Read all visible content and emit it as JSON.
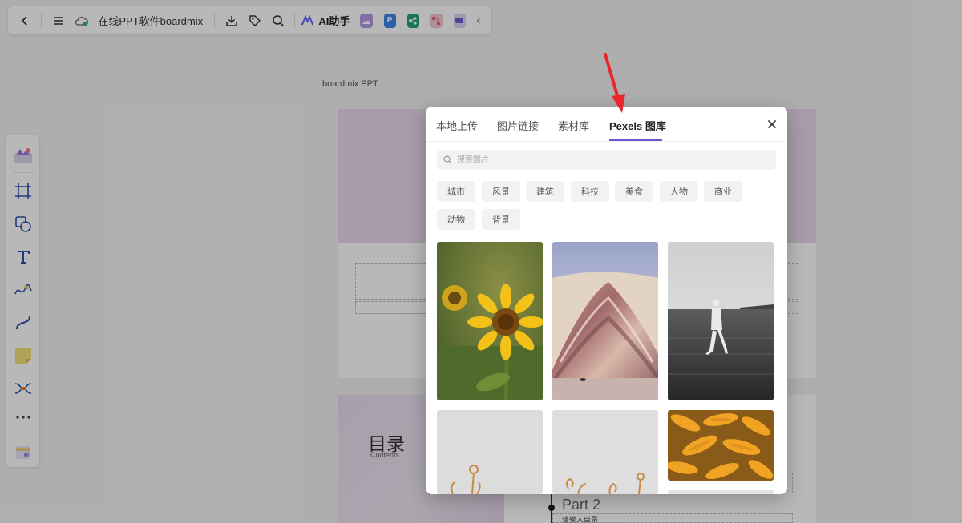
{
  "topbar": {
    "doc_title": "在线PPT软件boardmix",
    "ai_label": "AI助手",
    "apps": [
      {
        "icon": "image-app-icon",
        "color": "#a98ad6"
      },
      {
        "icon": "p-app-icon",
        "label": "P",
        "color": "#3a86e6"
      },
      {
        "icon": "mindmap-app-icon",
        "color": "#1fa37a"
      },
      {
        "icon": "flow-app-icon",
        "color": "#e07a8c"
      },
      {
        "icon": "chat-app-icon",
        "color": "#6b63d6"
      }
    ]
  },
  "canvas": {
    "label": "boardmix PPT",
    "toc_title": "目录",
    "toc_sub": "Contents",
    "part2": "Part 2",
    "part2_sub": "请输入目录"
  },
  "modal": {
    "tabs": [
      "本地上传",
      "图片链接",
      "素材库",
      "Pexels 图库"
    ],
    "active_tab": "Pexels 图库",
    "search_placeholder": "搜索图片",
    "categories": [
      "城市",
      "风景",
      "建筑",
      "科技",
      "美食",
      "人物",
      "商业",
      "动物",
      "背景"
    ],
    "images": [
      {
        "name": "sunflower-image"
      },
      {
        "name": "painted-hills-image"
      },
      {
        "name": "person-in-water-image"
      },
      {
        "name": "dried-flower-image-1"
      },
      {
        "name": "dried-flower-image-2"
      },
      {
        "name": "corn-image"
      }
    ]
  },
  "colors": {
    "accent": "#6b56d8",
    "arrow": "#e8262b"
  }
}
